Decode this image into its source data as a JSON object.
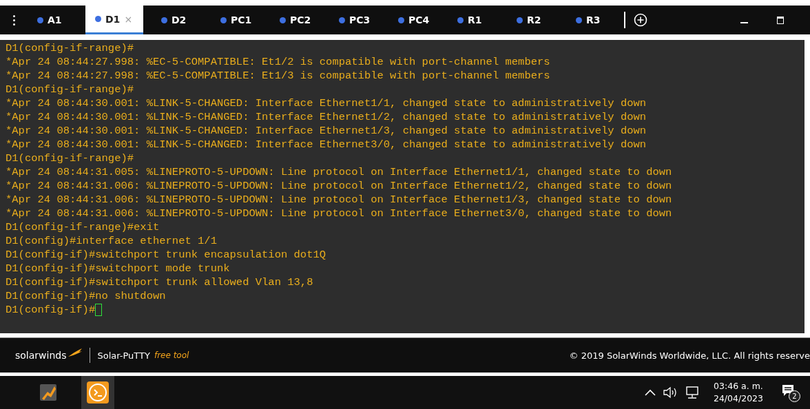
{
  "tabs": [
    {
      "label": "A1",
      "selected": false
    },
    {
      "label": "D1",
      "selected": true,
      "close": "×"
    },
    {
      "label": "D2",
      "selected": false
    },
    {
      "label": "PC1",
      "selected": false
    },
    {
      "label": "PC2",
      "selected": false
    },
    {
      "label": "PC3",
      "selected": false
    },
    {
      "label": "PC4",
      "selected": false
    },
    {
      "label": "R1",
      "selected": false
    },
    {
      "label": "R2",
      "selected": false
    },
    {
      "label": "R3",
      "selected": false
    }
  ],
  "terminal": {
    "cursor": true,
    "lines": [
      "D1(config-if-range)#",
      "*Apr 24 08:44:27.998: %EC-5-COMPATIBLE: Et1/2 is compatible with port-channel members",
      "*Apr 24 08:44:27.998: %EC-5-COMPATIBLE: Et1/3 is compatible with port-channel members",
      "D1(config-if-range)#",
      "*Apr 24 08:44:30.001: %LINK-5-CHANGED: Interface Ethernet1/1, changed state to administratively down",
      "*Apr 24 08:44:30.001: %LINK-5-CHANGED: Interface Ethernet1/2, changed state to administratively down",
      "*Apr 24 08:44:30.001: %LINK-5-CHANGED: Interface Ethernet1/3, changed state to administratively down",
      "*Apr 24 08:44:30.001: %LINK-5-CHANGED: Interface Ethernet3/0, changed state to administratively down",
      "D1(config-if-range)#",
      "*Apr 24 08:44:31.005: %LINEPROTO-5-UPDOWN: Line protocol on Interface Ethernet1/1, changed state to down",
      "*Apr 24 08:44:31.006: %LINEPROTO-5-UPDOWN: Line protocol on Interface Ethernet1/2, changed state to down",
      "*Apr 24 08:44:31.006: %LINEPROTO-5-UPDOWN: Line protocol on Interface Ethernet1/3, changed state to down",
      "*Apr 24 08:44:31.006: %LINEPROTO-5-UPDOWN: Line protocol on Interface Ethernet3/0, changed state to down",
      "D1(config-if-range)#exit",
      "D1(config)#interface ethernet 1/1",
      "D1(config-if)#switchport trunk encapsulation dot1Q",
      "D1(config-if)#switchport mode trunk",
      "D1(config-if)#switchport trunk allowed Vlan 13,8",
      "D1(config-if)#no shutdown",
      "D1(config-if)#"
    ]
  },
  "footer": {
    "brand": "solarwinds",
    "product": "Solar-PuTTY",
    "tag": "free tool",
    "copyright": "© 2019 SolarWinds Worldwide, LLC. All rights reserve"
  },
  "taskbar": {
    "time": "03:46 a. m.",
    "date": "24/04/2023",
    "notifications": "2"
  }
}
